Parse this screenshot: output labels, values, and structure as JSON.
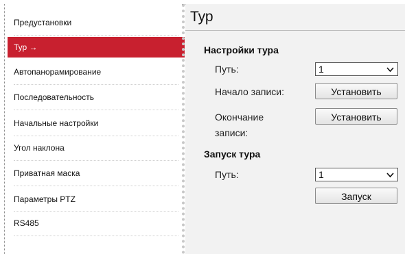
{
  "sidebar": {
    "items": [
      {
        "label": "Предустановки"
      },
      {
        "label": "Тур →"
      },
      {
        "label": "Автопанорамирование"
      },
      {
        "label": "Последовательность"
      },
      {
        "label": "Начальные настройки"
      },
      {
        "label": "Угол наклона"
      },
      {
        "label": "Приватная маска"
      },
      {
        "label": "Параметры PTZ"
      },
      {
        "label": "RS485"
      }
    ],
    "active_index": 1
  },
  "page": {
    "title": "Тур"
  },
  "tour_settings": {
    "heading": "Настройки тура",
    "path_label": "Путь:",
    "path_value": "1",
    "record_start_label": "Начало записи:",
    "record_start_button": "Установить",
    "record_end_label_line1": "Окончание",
    "record_end_label_line2": "записи:",
    "record_end_button": "Установить"
  },
  "tour_run": {
    "heading": "Запуск тура",
    "path_label": "Путь:",
    "path_value": "1",
    "start_button": "Запуск"
  },
  "colors": {
    "accent": "#c8202f",
    "content_bg": "#f2f2f2"
  }
}
